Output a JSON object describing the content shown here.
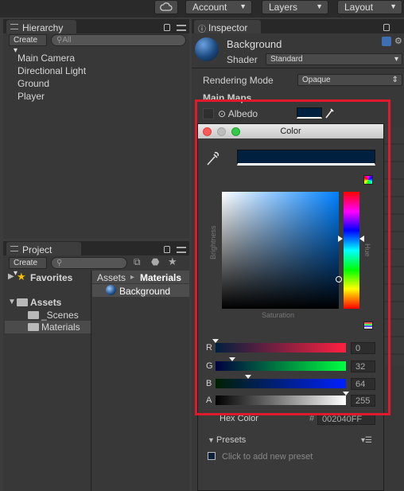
{
  "toolbar": {
    "account": "Account",
    "layers": "Layers",
    "layout": "Layout"
  },
  "hierarchy": {
    "tab": "Hierarchy",
    "create": "Create",
    "search_placeholder": "All",
    "items": [
      "Main Camera",
      "Directional Light",
      "Ground",
      "Player"
    ]
  },
  "project": {
    "tab": "Project",
    "create": "Create",
    "tree": {
      "favorites": "Favorites",
      "assets": "Assets",
      "scenes": "_Scenes",
      "materials": "Materials"
    },
    "breadcrumb": {
      "root": "Assets",
      "sep": "▸",
      "current": "Materials"
    },
    "files": [
      "Background"
    ]
  },
  "inspector": {
    "tab": "Inspector",
    "name": "Background",
    "shader_label": "Shader",
    "shader_value": "Standard",
    "rendering_mode_label": "Rendering Mode",
    "rendering_mode_value": "Opaque",
    "main_maps": "Main Maps",
    "albedo_label": "⊙ Albedo",
    "albedo_color": "#002040"
  },
  "color_picker": {
    "title": "Color",
    "current_color": "#002040",
    "brightness_label": "Brightness",
    "saturation_label": "Saturation",
    "hue_label": "Hue",
    "channels": [
      {
        "label": "R",
        "value": "0",
        "fraction": 0.0
      },
      {
        "label": "G",
        "value": "32",
        "fraction": 0.125
      },
      {
        "label": "B",
        "value": "64",
        "fraction": 0.25
      },
      {
        "label": "A",
        "value": "255",
        "fraction": 1.0
      }
    ],
    "hex_label": "Hex Color",
    "hex_hash": "#",
    "hex_value": "002040FF",
    "presets_label": "Presets",
    "presets_hint": "Click to add new preset"
  }
}
